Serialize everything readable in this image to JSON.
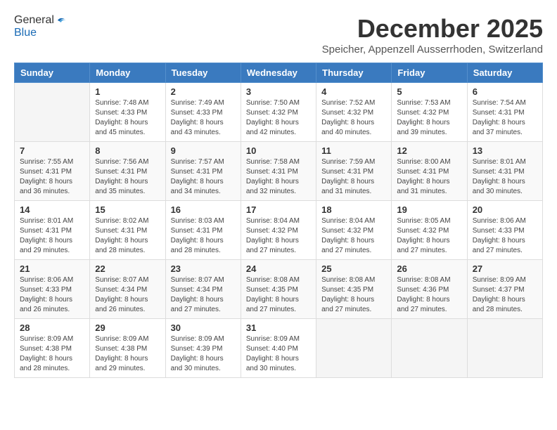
{
  "header": {
    "logo_line1": "General",
    "logo_line2": "Blue",
    "month_title": "December 2025",
    "subtitle": "Speicher, Appenzell Ausserrhoden, Switzerland"
  },
  "weekdays": [
    "Sunday",
    "Monday",
    "Tuesday",
    "Wednesday",
    "Thursday",
    "Friday",
    "Saturday"
  ],
  "weeks": [
    [
      {
        "day": "",
        "info": ""
      },
      {
        "day": "1",
        "info": "Sunrise: 7:48 AM\nSunset: 4:33 PM\nDaylight: 8 hours\nand 45 minutes."
      },
      {
        "day": "2",
        "info": "Sunrise: 7:49 AM\nSunset: 4:33 PM\nDaylight: 8 hours\nand 43 minutes."
      },
      {
        "day": "3",
        "info": "Sunrise: 7:50 AM\nSunset: 4:32 PM\nDaylight: 8 hours\nand 42 minutes."
      },
      {
        "day": "4",
        "info": "Sunrise: 7:52 AM\nSunset: 4:32 PM\nDaylight: 8 hours\nand 40 minutes."
      },
      {
        "day": "5",
        "info": "Sunrise: 7:53 AM\nSunset: 4:32 PM\nDaylight: 8 hours\nand 39 minutes."
      },
      {
        "day": "6",
        "info": "Sunrise: 7:54 AM\nSunset: 4:31 PM\nDaylight: 8 hours\nand 37 minutes."
      }
    ],
    [
      {
        "day": "7",
        "info": "Sunrise: 7:55 AM\nSunset: 4:31 PM\nDaylight: 8 hours\nand 36 minutes."
      },
      {
        "day": "8",
        "info": "Sunrise: 7:56 AM\nSunset: 4:31 PM\nDaylight: 8 hours\nand 35 minutes."
      },
      {
        "day": "9",
        "info": "Sunrise: 7:57 AM\nSunset: 4:31 PM\nDaylight: 8 hours\nand 34 minutes."
      },
      {
        "day": "10",
        "info": "Sunrise: 7:58 AM\nSunset: 4:31 PM\nDaylight: 8 hours\nand 32 minutes."
      },
      {
        "day": "11",
        "info": "Sunrise: 7:59 AM\nSunset: 4:31 PM\nDaylight: 8 hours\nand 31 minutes."
      },
      {
        "day": "12",
        "info": "Sunrise: 8:00 AM\nSunset: 4:31 PM\nDaylight: 8 hours\nand 31 minutes."
      },
      {
        "day": "13",
        "info": "Sunrise: 8:01 AM\nSunset: 4:31 PM\nDaylight: 8 hours\nand 30 minutes."
      }
    ],
    [
      {
        "day": "14",
        "info": "Sunrise: 8:01 AM\nSunset: 4:31 PM\nDaylight: 8 hours\nand 29 minutes."
      },
      {
        "day": "15",
        "info": "Sunrise: 8:02 AM\nSunset: 4:31 PM\nDaylight: 8 hours\nand 28 minutes."
      },
      {
        "day": "16",
        "info": "Sunrise: 8:03 AM\nSunset: 4:31 PM\nDaylight: 8 hours\nand 28 minutes."
      },
      {
        "day": "17",
        "info": "Sunrise: 8:04 AM\nSunset: 4:32 PM\nDaylight: 8 hours\nand 27 minutes."
      },
      {
        "day": "18",
        "info": "Sunrise: 8:04 AM\nSunset: 4:32 PM\nDaylight: 8 hours\nand 27 minutes."
      },
      {
        "day": "19",
        "info": "Sunrise: 8:05 AM\nSunset: 4:32 PM\nDaylight: 8 hours\nand 27 minutes."
      },
      {
        "day": "20",
        "info": "Sunrise: 8:06 AM\nSunset: 4:33 PM\nDaylight: 8 hours\nand 27 minutes."
      }
    ],
    [
      {
        "day": "21",
        "info": "Sunrise: 8:06 AM\nSunset: 4:33 PM\nDaylight: 8 hours\nand 26 minutes."
      },
      {
        "day": "22",
        "info": "Sunrise: 8:07 AM\nSunset: 4:34 PM\nDaylight: 8 hours\nand 26 minutes."
      },
      {
        "day": "23",
        "info": "Sunrise: 8:07 AM\nSunset: 4:34 PM\nDaylight: 8 hours\nand 27 minutes."
      },
      {
        "day": "24",
        "info": "Sunrise: 8:08 AM\nSunset: 4:35 PM\nDaylight: 8 hours\nand 27 minutes."
      },
      {
        "day": "25",
        "info": "Sunrise: 8:08 AM\nSunset: 4:35 PM\nDaylight: 8 hours\nand 27 minutes."
      },
      {
        "day": "26",
        "info": "Sunrise: 8:08 AM\nSunset: 4:36 PM\nDaylight: 8 hours\nand 27 minutes."
      },
      {
        "day": "27",
        "info": "Sunrise: 8:09 AM\nSunset: 4:37 PM\nDaylight: 8 hours\nand 28 minutes."
      }
    ],
    [
      {
        "day": "28",
        "info": "Sunrise: 8:09 AM\nSunset: 4:38 PM\nDaylight: 8 hours\nand 28 minutes."
      },
      {
        "day": "29",
        "info": "Sunrise: 8:09 AM\nSunset: 4:38 PM\nDaylight: 8 hours\nand 29 minutes."
      },
      {
        "day": "30",
        "info": "Sunrise: 8:09 AM\nSunset: 4:39 PM\nDaylight: 8 hours\nand 30 minutes."
      },
      {
        "day": "31",
        "info": "Sunrise: 8:09 AM\nSunset: 4:40 PM\nDaylight: 8 hours\nand 30 minutes."
      },
      {
        "day": "",
        "info": ""
      },
      {
        "day": "",
        "info": ""
      },
      {
        "day": "",
        "info": ""
      }
    ]
  ]
}
